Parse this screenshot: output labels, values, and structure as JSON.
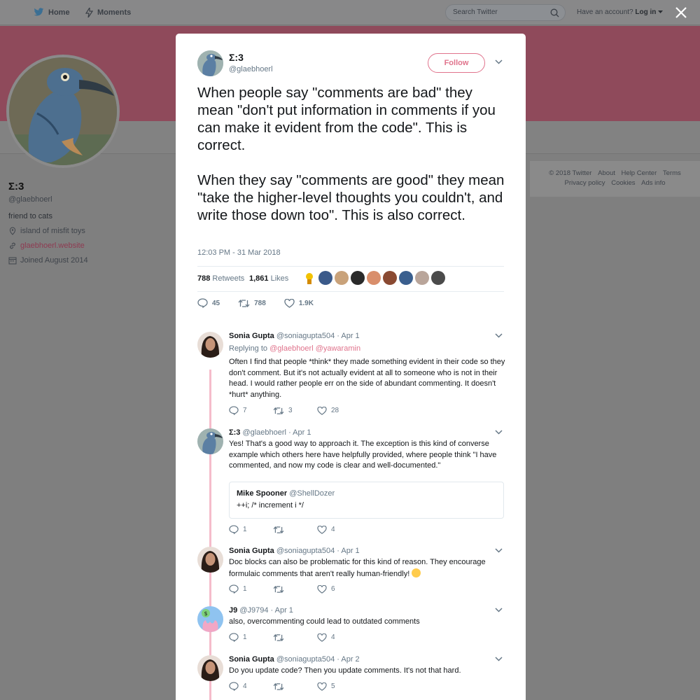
{
  "nav": {
    "home": "Home",
    "moments": "Moments",
    "search_placeholder": "Search Twitter",
    "have_account": "Have an account?",
    "login": "Log in"
  },
  "profile": {
    "name": "Σ:3",
    "handle": "@glaebhoerl",
    "bio": "friend to cats",
    "location": "island of misfit toys",
    "website": "glaebhoerl.website",
    "joined": "Joined August 2014",
    "accent_color": "#e0738c"
  },
  "footer": {
    "links": [
      "© 2018 Twitter",
      "About",
      "Help Center",
      "Terms",
      "Privacy policy",
      "Cookies",
      "Ads info"
    ]
  },
  "tweet": {
    "name": "Σ:3",
    "handle": "@glaebhoerl",
    "follow_label": "Follow",
    "text": "When people say \"comments are bad\" they mean \"don't put information in comments if you can make it evident from the code\". This is correct.\n\nWhen they say \"comments are good\" they mean \"take the higher-level thoughts you couldn't, and write those down too\". This is also correct.",
    "timestamp": "12:03 PM - 31 Mar 2018",
    "retweets_count": "788",
    "retweets_label": "Retweets",
    "likes_count": "1,861",
    "likes_label": "Likes",
    "replies_action": "45",
    "retweets_action": "788",
    "likes_action": "1.9K"
  },
  "replies": [
    {
      "name": "Sonia Gupta",
      "handle": "@soniagupta504",
      "date": "· Apr 1",
      "replying_label": "Replying to",
      "replying_to": "@glaebhoerl @yawaramin",
      "text": "Often I find that people *think* they made something evident in their code so they don't comment. But it's not actually evident at all to someone who is not in their head. I would rather people err on the side of abundant commenting. It doesn't *hurt* anything.",
      "replies": "7",
      "retweets": "3",
      "likes": "28"
    },
    {
      "name": "Σ:3",
      "handle": "@glaebhoerl",
      "date": "· Apr 1",
      "text": "Yes! That's a good way to approach it. The exception is this kind of converse example which others here have helpfully provided, where people think \"I have commented, and now my code is clear and well-documented.\"",
      "quote_name": "Mike Spooner",
      "quote_handle": "@ShellDozer",
      "quote_text": "++i; /* increment i */",
      "replies": "1",
      "retweets": "",
      "likes": "4"
    },
    {
      "name": "Sonia Gupta",
      "handle": "@soniagupta504",
      "date": "· Apr 1",
      "text": "Doc blocks can also be problematic for this kind of reason. They encourage formulaic comments that aren't really human-friendly!",
      "replies": "1",
      "retweets": "",
      "likes": "6"
    },
    {
      "name": "J9",
      "handle": "@J9794",
      "date": "· Apr 1",
      "text": "also, overcommenting could lead to outdated comments",
      "replies": "1",
      "retweets": "",
      "likes": "4"
    },
    {
      "name": "Sonia Gupta",
      "handle": "@soniagupta504",
      "date": "· Apr 2",
      "text": "Do you update code? Then you update comments. It's not that hard.",
      "replies": "4",
      "retweets": "",
      "likes": "5"
    }
  ]
}
